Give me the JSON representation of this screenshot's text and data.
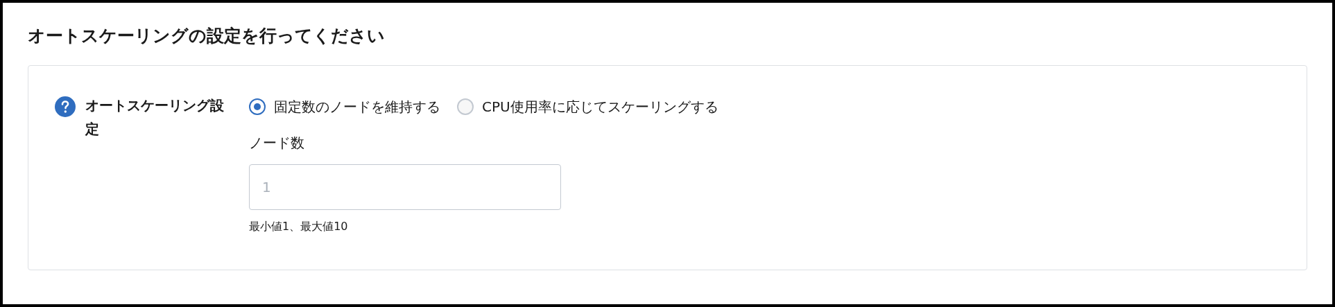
{
  "title": "オートスケーリングの設定を行ってください",
  "setting": {
    "label": "オートスケーリング設定",
    "options": [
      {
        "label": "固定数のノードを維持する",
        "selected": true
      },
      {
        "label": "CPU使用率に応じてスケーリングする",
        "selected": false
      }
    ],
    "node_count": {
      "label": "ノード数",
      "placeholder": "1",
      "hint": "最小値1、最大値10"
    }
  }
}
